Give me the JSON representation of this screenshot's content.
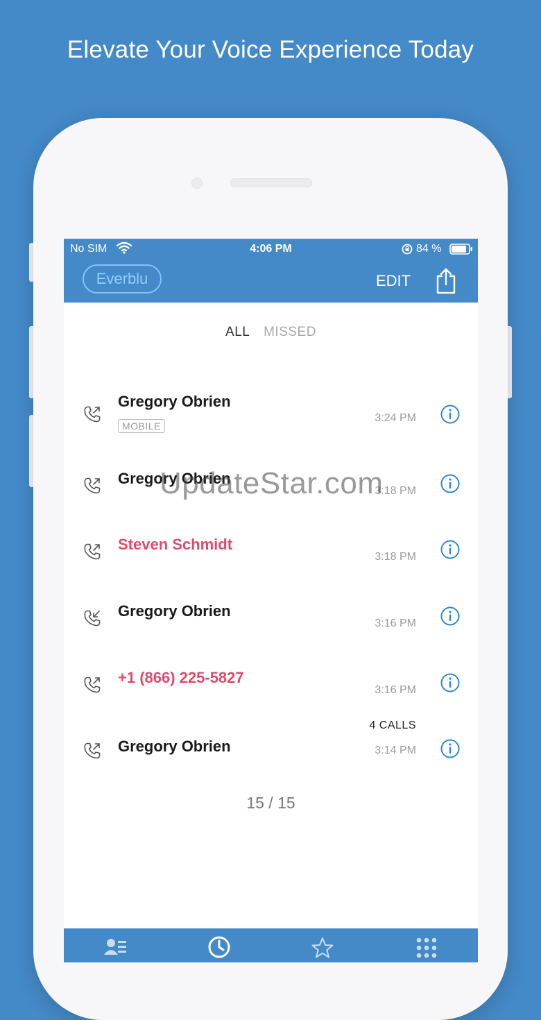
{
  "headline": "Elevate Your Voice Experience Today",
  "status": {
    "carrier": "No SIM",
    "time": "4:06 PM",
    "battery": "84 %"
  },
  "header": {
    "brand": "Everblu",
    "edit_label": "EDIT"
  },
  "tabs": {
    "all": "ALL",
    "missed": "MISSED"
  },
  "calls": [
    {
      "name": "Gregory Obrien",
      "badge": "MOBILE",
      "time": "3:24 PM",
      "type": "outgoing",
      "missed": false
    },
    {
      "name": "Gregory Obrien",
      "time": "3:18 PM",
      "type": "outgoing",
      "missed": false
    },
    {
      "name": "Steven Schmidt",
      "time": "3:18 PM",
      "type": "outgoing",
      "missed": true
    },
    {
      "name": "Gregory Obrien",
      "time": "3:16 PM",
      "type": "incoming",
      "missed": false
    },
    {
      "name": "+1 (866) 225-5827",
      "time": "3:16 PM",
      "type": "outgoing",
      "missed": true
    },
    {
      "name": "Gregory Obrien",
      "count": "4 CALLS",
      "time": "3:14 PM",
      "type": "outgoing",
      "missed": false
    }
  ],
  "pager": "15 / 15",
  "watermark": "UpdateStar.com",
  "bottom_tabs": [
    "contacts-icon",
    "recents-clock-icon",
    "favorites-star-icon",
    "keypad-icon"
  ],
  "colors": {
    "brand_blue": "#4489c8",
    "missed_red": "#e14a6c",
    "info_blue": "#2f86d6"
  }
}
